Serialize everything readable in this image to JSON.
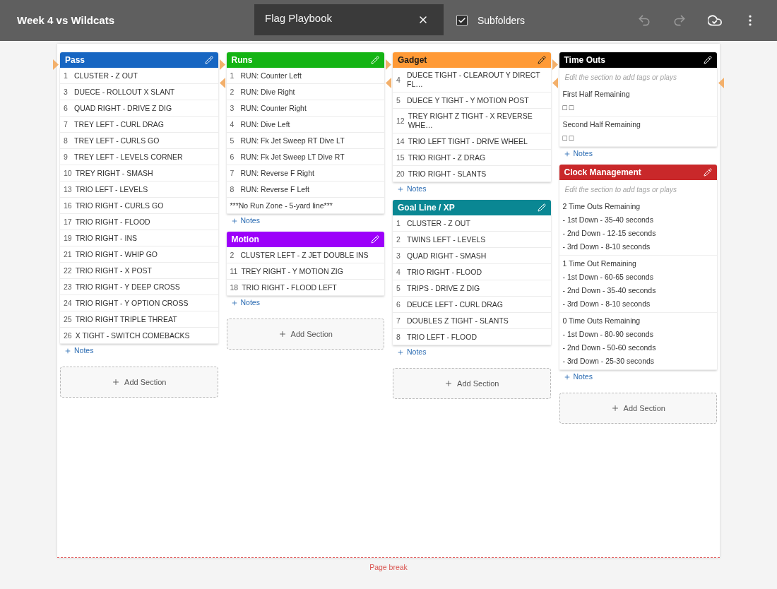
{
  "header": {
    "title": "Week 4 vs Wildcats",
    "playbook": {
      "value": "Flag Playbook"
    },
    "subfolders": {
      "label": "Subfolders",
      "checked": true
    },
    "toolbar": [
      {
        "kind": "undo",
        "disabled": true
      },
      {
        "kind": "redo",
        "disabled": true
      },
      {
        "kind": "cloud_sync",
        "disabled": false
      },
      {
        "kind": "more",
        "disabled": false
      }
    ]
  },
  "columns": [
    {
      "sections": [
        {
          "title": "Pass",
          "color": "#1766c2",
          "kind": "plays",
          "plays": [
            {
              "number": "1",
              "name": "CLUSTER - Z OUT"
            },
            {
              "number": "3",
              "name": "DUECE - ROLLOUT X SLANT"
            },
            {
              "number": "6",
              "name": "QUAD RIGHT - DRIVE Z DIG"
            },
            {
              "number": "7",
              "name": "TREY LEFT - CURL DRAG"
            },
            {
              "number": "8",
              "name": "TREY LEFT - CURLS GO"
            },
            {
              "number": "9",
              "name": "TREY LEFT - LEVELS CORNER"
            },
            {
              "number": "10",
              "name": "TREY RIGHT - SMASH"
            },
            {
              "number": "13",
              "name": "TRIO LEFT - LEVELS"
            },
            {
              "number": "16",
              "name": "TRIO RIGHT - CURLS GO"
            },
            {
              "number": "17",
              "name": "TRIO RIGHT - FLOOD"
            },
            {
              "number": "19",
              "name": "TRIO RIGHT - INS"
            },
            {
              "number": "21",
              "name": "TRIO RIGHT - WHIP GO"
            },
            {
              "number": "22",
              "name": "TRIO RIGHT - X POST"
            },
            {
              "number": "23",
              "name": "TRIO RIGHT - Y DEEP CROSS"
            },
            {
              "number": "24",
              "name": "TRIO RIGHT - Y OPTION CROSS"
            },
            {
              "number": "25",
              "name": "TRIO RIGHT TRIPLE THREAT"
            },
            {
              "number": "26",
              "name": "X TIGHT - SWITCH COMEBACKS"
            }
          ],
          "notes": "Notes"
        }
      ],
      "add_section": "Add Section"
    },
    {
      "sections": [
        {
          "title": "Runs",
          "color": "#14b414",
          "kind": "plays",
          "plays": [
            {
              "number": "1",
              "name": "RUN: Counter Left"
            },
            {
              "number": "2",
              "name": "RUN: Dive Right"
            },
            {
              "number": "3",
              "name": "RUN: Counter Right"
            },
            {
              "number": "4",
              "name": "RUN: Dive Left"
            },
            {
              "number": "5",
              "name": "RUN: Fk Jet Sweep RT Dive LT"
            },
            {
              "number": "6",
              "name": "RUN: Fk Jet Sweep LT Dive RT"
            },
            {
              "number": "7",
              "name": "RUN: Reverse F Right"
            },
            {
              "number": "8",
              "name": "RUN: Reverse F Left"
            },
            {
              "name": "***No Run Zone - 5-yard line***"
            }
          ],
          "notes": "Notes"
        },
        {
          "title": "Motion",
          "color": "#9c00fa",
          "kind": "plays",
          "plays": [
            {
              "number": "2",
              "name": "CLUSTER LEFT - Z JET DOUBLE INS"
            },
            {
              "number": "11",
              "name": "TREY RIGHT - Y MOTION ZIG"
            },
            {
              "number": "18",
              "name": "TRIO RIGHT - FLOOD LEFT"
            }
          ],
          "notes": "Notes"
        }
      ],
      "add_section": "Add Section"
    },
    {
      "sections": [
        {
          "title": "Gadget",
          "color": "#ff9a36",
          "kind": "plays",
          "plays": [
            {
              "number": "4",
              "name": "DUECE TIGHT - CLEAROUT Y DIRECT FL…"
            },
            {
              "number": "5",
              "name": "DUECE Y TIGHT - Y MOTION POST"
            },
            {
              "number": "12",
              "name": "TREY RIGHT Z TIGHT - X REVERSE WHE…"
            },
            {
              "number": "14",
              "name": "TRIO LEFT TIGHT - DRIVE WHEEL"
            },
            {
              "number": "15",
              "name": "TRIO RIGHT - Z DRAG"
            },
            {
              "number": "20",
              "name": "TRIO RIGHT - SLANTS"
            }
          ],
          "notes": "Notes"
        },
        {
          "title": "Goal Line / XP",
          "color": "#0a8793",
          "kind": "plays",
          "plays": [
            {
              "number": "1",
              "name": "CLUSTER - Z OUT"
            },
            {
              "number": "2",
              "name": "TWINS LEFT - LEVELS"
            },
            {
              "number": "3",
              "name": "QUAD RIGHT - SMASH"
            },
            {
              "number": "4",
              "name": "TRIO RIGHT - FLOOD"
            },
            {
              "number": "5",
              "name": "TRIPS - DRIVE Z DIG"
            },
            {
              "number": "6",
              "name": "DEUCE LEFT - CURL DRAG"
            },
            {
              "number": "7",
              "name": "DOUBLES Z TIGHT - SLANTS"
            },
            {
              "number": "8",
              "name": "TRIO LEFT - FLOOD"
            }
          ],
          "notes": "Notes"
        }
      ],
      "add_section": "Add Section"
    },
    {
      "sections": [
        {
          "title": "Time Outs",
          "color": "#000000",
          "kind": "text",
          "hint": "Edit the section to add tags or plays",
          "blocks": [
            {
              "lines": [
                "First Half Remaining",
                "□ □"
              ]
            },
            {
              "lines": [
                "Second Half Remaining",
                "□ □"
              ]
            }
          ],
          "notes": "Notes"
        },
        {
          "title": "Clock Management",
          "color": "#c9282a",
          "kind": "text",
          "hint": "Edit the section to add tags or plays",
          "blocks": [
            {
              "lines": [
                "2 Time Outs Remaining",
                "- 1st Down - 35-40 seconds",
                "- 2nd Down - 12-15 seconds",
                "- 3rd Down - 8-10 seconds"
              ]
            },
            {
              "lines": [
                "1 Time Out Remaining",
                "- 1st Down - 60-65 seconds",
                "- 2nd Down - 35-40 seconds",
                "- 3rd Down - 8-10 seconds"
              ]
            },
            {
              "lines": [
                "0 Time Outs Remaining",
                "- 1st Down - 80-90 seconds",
                "- 2nd Down - 50-60 seconds",
                "- 3rd Down - 25-30 seconds"
              ]
            }
          ],
          "notes": "Notes"
        }
      ],
      "add_section": "Add Section"
    }
  ],
  "page_break": "Page break"
}
